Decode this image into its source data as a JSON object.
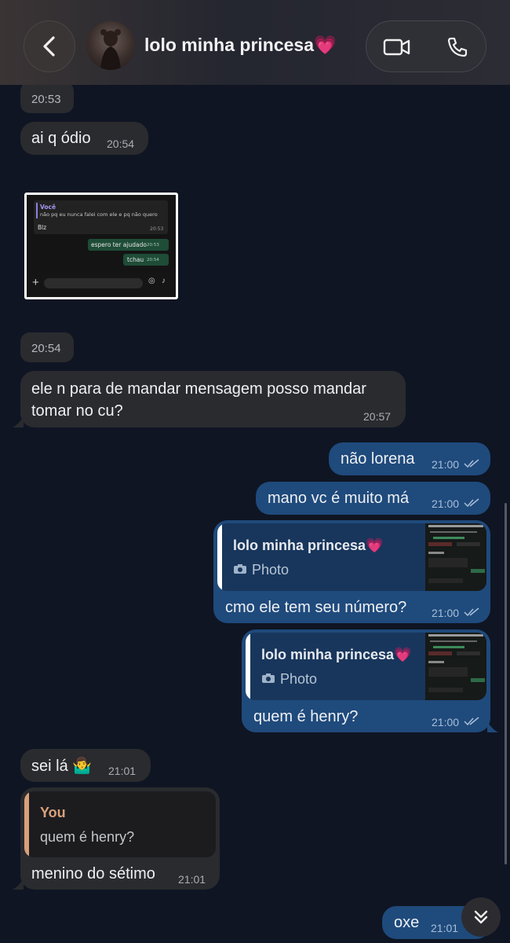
{
  "header": {
    "title": "lolo minha princesa💗"
  },
  "messages": {
    "date1": "20:53",
    "m1": {
      "text": "ai q ódio",
      "time": "20:54"
    },
    "image": {
      "quote_name": "Você",
      "quote_text": "não pq eu nunca falei com ele e pq não quero",
      "reply": "Blz",
      "reply_time": "20:53",
      "out1": "espero ter ajudado",
      "out1_time": "20:53",
      "out2": "tchau",
      "out2_time": "20:54"
    },
    "date2": "20:54",
    "m2": {
      "line1": "ele n para de mandar mensagem posso mandar",
      "line2": "tomar no cu?",
      "time": "20:57"
    },
    "m3": {
      "text": "não lorena",
      "time": "21:00"
    },
    "m4": {
      "text": "mano vc é muito má",
      "time": "21:00"
    },
    "m5": {
      "quote_name": "lolo minha princesa💗",
      "quote_type": "Photo",
      "text": "cmo ele tem seu número?",
      "time": "21:00"
    },
    "m6": {
      "quote_name": "lolo minha princesa💗",
      "quote_type": "Photo",
      "text": "quem é henry?",
      "time": "21:00"
    },
    "m7": {
      "text": "sei lá 🤷‍♂️",
      "time": "21:01"
    },
    "m8": {
      "quote_name": "You",
      "quote_text": "quem é henry?",
      "text": "menino do sétimo",
      "time": "21:01"
    },
    "m9": {
      "text": "oxe",
      "time": "21:01"
    }
  },
  "colors": {
    "background": "#0f1523",
    "incoming": "#2a2b2e",
    "outgoing": "#1f4a7c",
    "quote_you": "#d9a07a"
  }
}
